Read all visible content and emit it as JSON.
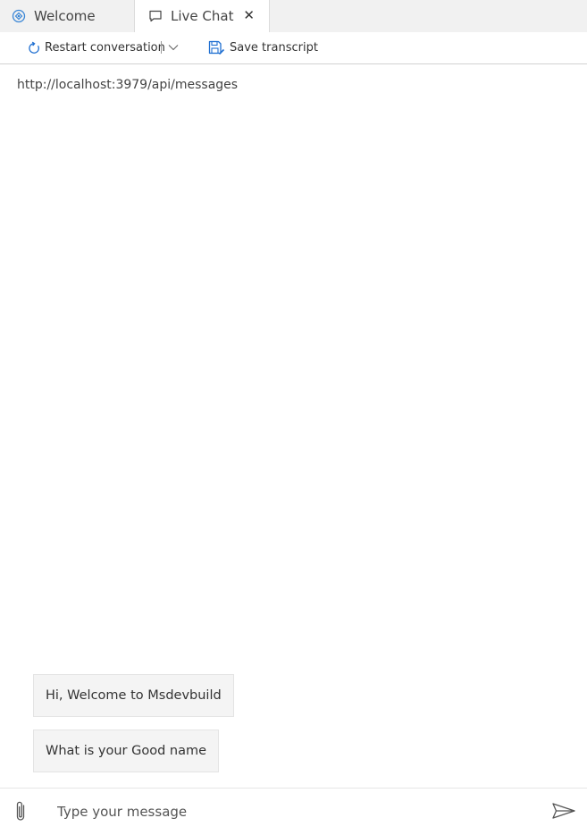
{
  "tabs": [
    {
      "label": "Welcome",
      "icon": "bot-emulator-icon",
      "active": false
    },
    {
      "label": "Live Chat",
      "icon": "chat-bubble-icon",
      "active": true,
      "close": "✕"
    }
  ],
  "toolbar": {
    "restart_label": "Restart conversation",
    "save_label": "Save transcript"
  },
  "endpoint": "http://localhost:3979/api/messages",
  "messages": [
    {
      "from": "bot",
      "text": "Hi, Welcome to Msdevbuild"
    },
    {
      "from": "bot",
      "text": "What is your Good name"
    }
  ],
  "composer": {
    "placeholder": "Type your message"
  },
  "colors": {
    "accent": "#1f6fd1",
    "tabbar_bg": "#f1f1f1",
    "bubble_bg": "#f4f4f4"
  }
}
